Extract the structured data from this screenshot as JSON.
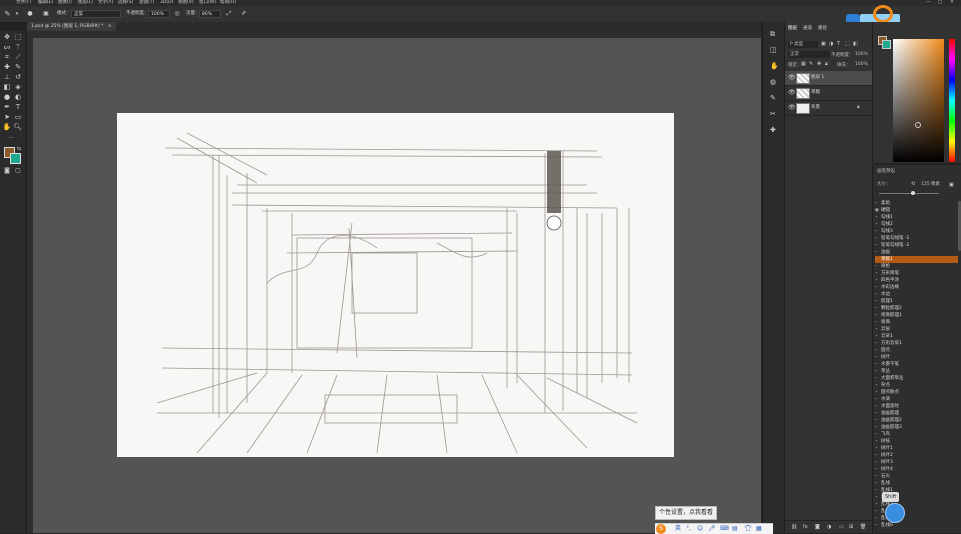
{
  "menubar": {
    "items": [
      "文件(F)",
      "编辑(E)",
      "图像(I)",
      "图层(L)",
      "文字(Y)",
      "选择(S)",
      "滤镜(T)",
      "3D(D)",
      "视图(V)",
      "窗口(W)",
      "帮助(H)"
    ]
  },
  "options": {
    "mode_label": "模式：",
    "mode_value": "正常",
    "opacity_label": "不透明度：",
    "opacity_value": "100%",
    "flow_label": "流量：",
    "flow_value": "80%"
  },
  "document": {
    "tab_title": "1.psd @ 25% (图层 1, RGB/8#) *"
  },
  "layers_panel": {
    "tabs": [
      "图层",
      "通道",
      "路径"
    ],
    "kind_filter": "P 类型",
    "blend_mode": "正常",
    "opacity_label": "不透明度：",
    "opacity_value": "100%",
    "lock_label": "锁定：",
    "fill_label": "填充：",
    "fill_value": "100%",
    "layers": [
      {
        "name": "图层 1"
      },
      {
        "name": "草稿"
      },
      {
        "name": "背景"
      }
    ]
  },
  "brush_panel": {
    "title": "画笔预设",
    "size_label": "大小：",
    "size_value": "125 像素",
    "items": [
      "柔角",
      "硬圆",
      "勾线1",
      "勾线2",
      "勾线3",
      "铅笔勾线笔 -1",
      "铅笔勾线笔 -2",
      "油画",
      "草稿1",
      "喷枪",
      "方形喷笔",
      "四色平涂",
      "水彩边缘",
      "水边",
      "肌理1",
      "颗粒肌理2",
      "喷溅肌理1",
      "喷溅",
      "云层",
      "云朵1",
      "方形云朵1",
      "圆点",
      "树叶",
      "水墨干笔",
      "草丛",
      "大面积草丛",
      "杂点",
      "圆点散点",
      "水滴",
      "水面波纹",
      "油画肌理",
      "油画肌理2",
      "油画肌理3",
      "飞鸟",
      "树枝",
      "树叶1",
      "树叶2",
      "树叶3",
      "树叶4",
      "石头",
      "乱线",
      "乱线1",
      "乱线2",
      "乱线3",
      "乱线4",
      "乱线5",
      "乱线6"
    ],
    "selected_index": 8
  },
  "tooltip": {
    "text": "个性设置，点我看看"
  },
  "shift_badge": "Shift",
  "colors": {
    "foreground": "#8a5a2b",
    "background": "#1faa8f",
    "accent_orange": "#f08a1a"
  }
}
